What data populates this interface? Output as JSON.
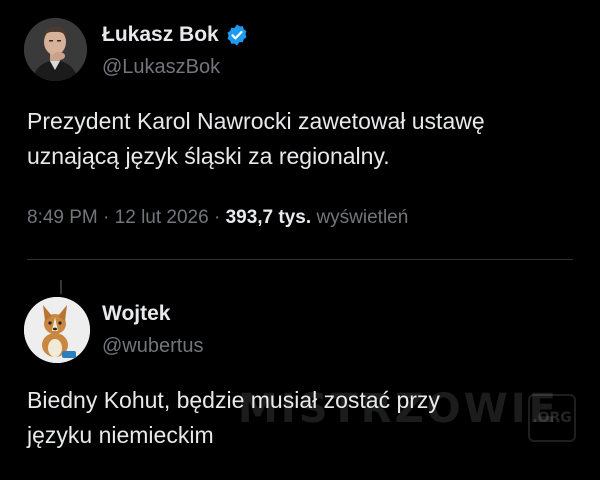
{
  "posts": [
    {
      "display_name": "Łukasz Bok",
      "verified": true,
      "handle": "@LukaszBok",
      "text_lines": [
        "Prezydent Karol Nawrocki zawetował ustawę",
        "uznającą język śląski za regionalny."
      ],
      "time": "8:49 PM",
      "date": "12 lut 2026",
      "views": "393,7 tys.",
      "views_label": "wyświetleń"
    },
    {
      "display_name": "Wojtek",
      "handle": "@wubertus",
      "text_lines": [
        "Biedny Kohut, będzie musiał zostać przy",
        "języku niemieckim"
      ]
    }
  ],
  "meta_separator": "·",
  "watermark": {
    "text": "MISTRZOWIE",
    "badge": ".ORG"
  },
  "colors": {
    "background": "#000000",
    "text": "#e7e9ea",
    "secondary_text": "#71767b",
    "verified_blue": "#1d9bf0",
    "divider": "#2f3336"
  }
}
